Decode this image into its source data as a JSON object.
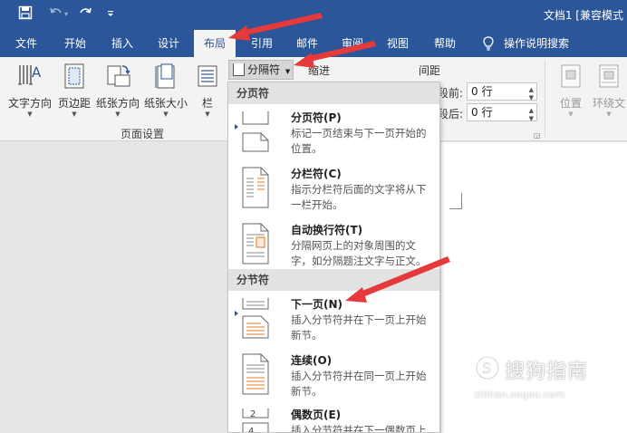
{
  "window": {
    "doc_title": "文档1 [兼容模式"
  },
  "tabs": [
    {
      "label": "文件"
    },
    {
      "label": "开始"
    },
    {
      "label": "插入"
    },
    {
      "label": "设计"
    },
    {
      "label": "布局",
      "active": true
    },
    {
      "label": "引用"
    },
    {
      "label": "邮件"
    },
    {
      "label": "审阅"
    },
    {
      "label": "视图"
    },
    {
      "label": "帮助"
    },
    {
      "label": "操作说明搜索"
    }
  ],
  "ribbon": {
    "page_setup": {
      "buttons": [
        {
          "label": "文字方向",
          "icon": "text-direction-icon"
        },
        {
          "label": "页边距",
          "icon": "margins-icon"
        },
        {
          "label": "纸张方向",
          "icon": "orientation-icon"
        },
        {
          "label": "纸张大小",
          "icon": "paper-size-icon"
        },
        {
          "label": "栏",
          "icon": "columns-icon"
        }
      ],
      "group_label": "页面设置",
      "breaks_label": "分隔符"
    },
    "paragraph": {
      "indent_label": "缩进",
      "spacing_label": "间距",
      "before_label": "段前:",
      "before_value": "0 行",
      "after_label": "段后:",
      "after_value": "0 行"
    },
    "arrange": {
      "position_label": "位置",
      "wrap_label": "环绕文"
    }
  },
  "menu": {
    "page_breaks_header": "分页符",
    "section_breaks_header": "分节符",
    "items": [
      {
        "title": "分页符(P)",
        "desc": "标记一页结束与下一页开始的位置。",
        "icon": "page-break-icon"
      },
      {
        "title": "分栏符(C)",
        "desc": "指示分栏符后面的文字将从下一栏开始。",
        "icon": "column-break-icon"
      },
      {
        "title": "自动换行符(T)",
        "desc": "分隔网页上的对象周围的文字，如分隔题注文字与正文。",
        "icon": "text-wrapping-break-icon"
      },
      {
        "title": "下一页(N)",
        "desc": "插入分节符并在下一页上开始新节。",
        "icon": "next-page-section-icon"
      },
      {
        "title": "连续(O)",
        "desc": "插入分节符并在同一页上开始新节。",
        "icon": "continuous-section-icon"
      },
      {
        "title": "偶数页(E)",
        "desc": "插入分节符并在下一偶数页上",
        "icon": "even-page-section-icon"
      }
    ]
  },
  "watermark": {
    "text": "搜狗指南",
    "url": "zhinan.sogou.com"
  },
  "colors": {
    "accent": "#2b579a",
    "annotation_arrow": "#e5393b"
  }
}
